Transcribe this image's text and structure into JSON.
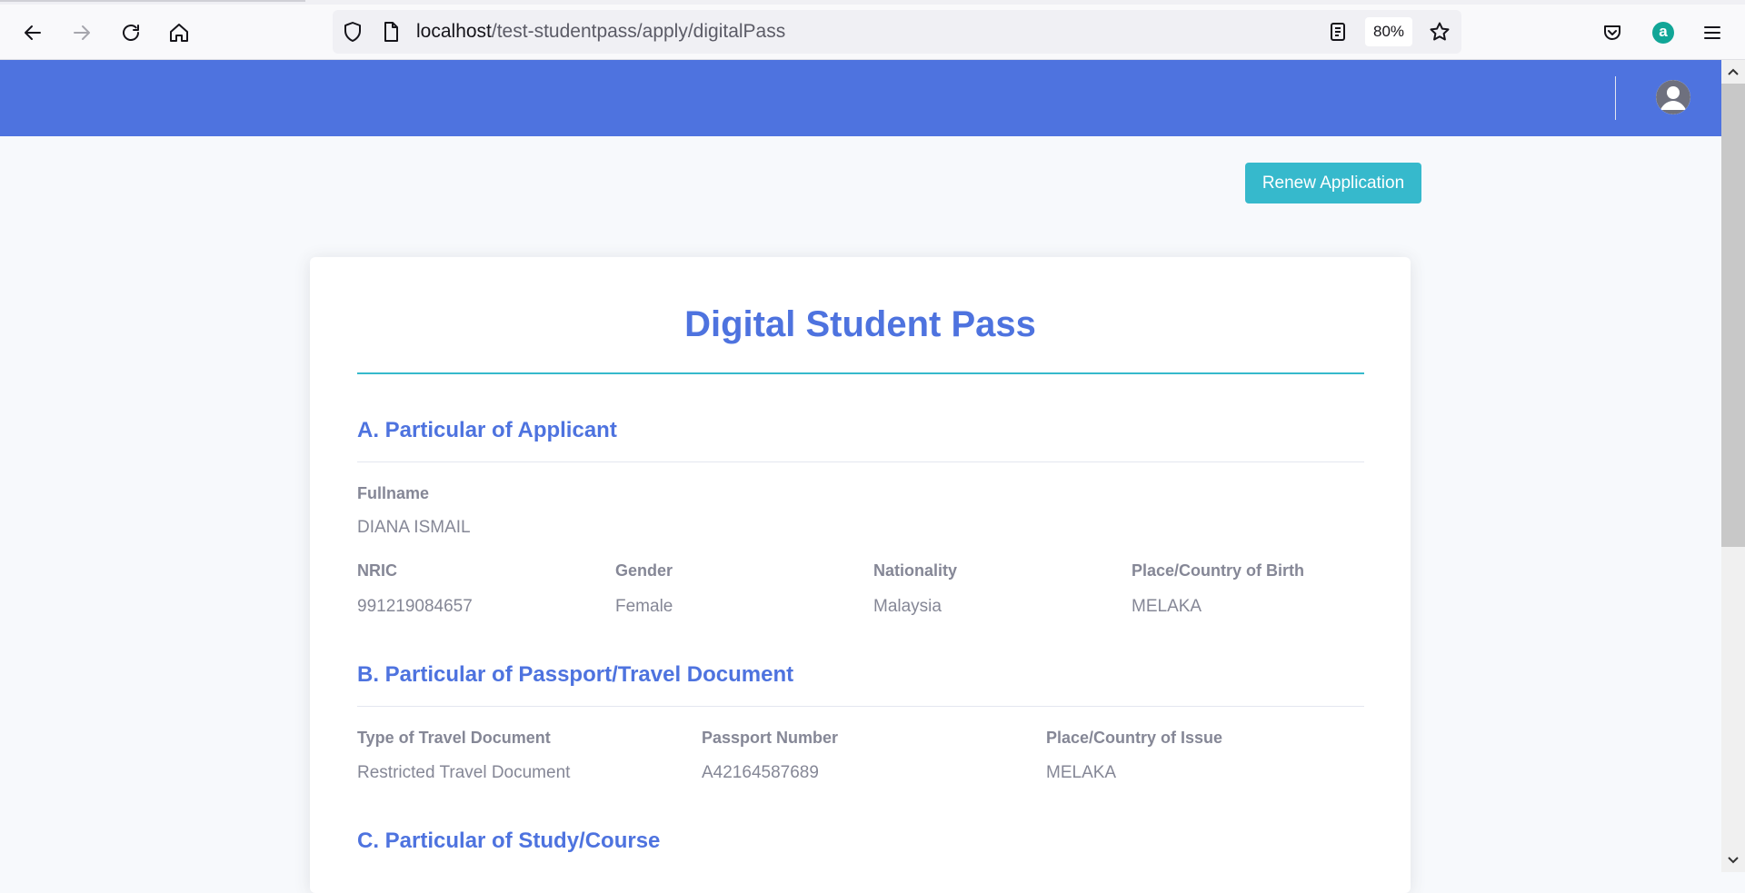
{
  "browser": {
    "url_host": "localhost",
    "url_path": "/test-studentpass/apply/digitalPass",
    "zoom": "80%"
  },
  "actions": {
    "renew_label": "Renew Application"
  },
  "card": {
    "title": "Digital Student Pass",
    "section_a": {
      "heading": "A. Particular of Applicant",
      "fullname_label": "Fullname",
      "fullname_value": "DIANA ISMAIL",
      "nric_label": "NRIC",
      "nric_value": "991219084657",
      "gender_label": "Gender",
      "gender_value": "Female",
      "nationality_label": "Nationality",
      "nationality_value": "Malaysia",
      "birth_label": "Place/Country of Birth",
      "birth_value": "MELAKA"
    },
    "section_b": {
      "heading": "B. Particular of Passport/Travel Document",
      "doc_type_label": "Type of Travel Document",
      "doc_type_value": "Restricted Travel Document",
      "passport_label": "Passport Number",
      "passport_value": "A42164587689",
      "issue_label": "Place/Country of Issue",
      "issue_value": "MELAKA"
    },
    "section_c": {
      "heading": "C. Particular of Study/Course"
    }
  },
  "colors": {
    "navbar": "#4e73df",
    "primary_text": "#4e73df",
    "renew_button": "#36b9cc",
    "muted_text": "#858796"
  }
}
